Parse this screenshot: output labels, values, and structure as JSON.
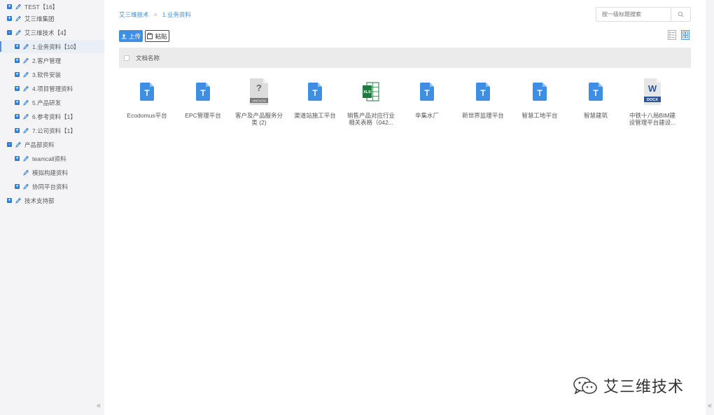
{
  "sidebar": {
    "items": [
      {
        "label": "TEST【16】",
        "toggle": "+"
      },
      {
        "label": "艾三维集团",
        "toggle": "+"
      },
      {
        "label": "艾三维技术【4】",
        "toggle": "-"
      },
      {
        "label": "1.业务资料【10】",
        "toggle": "+"
      },
      {
        "label": "2.客户管理",
        "toggle": "+"
      },
      {
        "label": "3.软件安装",
        "toggle": "+"
      },
      {
        "label": "4.项目管理资料",
        "toggle": "+"
      },
      {
        "label": "5.产品研发",
        "toggle": "+"
      },
      {
        "label": "6.参考资料【1】",
        "toggle": "+"
      },
      {
        "label": "7.公司资料【1】",
        "toggle": "+"
      },
      {
        "label": "产品部资料",
        "toggle": "-"
      },
      {
        "label": "teamcall资料",
        "toggle": "+"
      },
      {
        "label": "模拟构建资料",
        "toggle": ""
      },
      {
        "label": "协同平台资料",
        "toggle": "+"
      },
      {
        "label": "技术支持部",
        "toggle": "+"
      }
    ],
    "collapse": "«"
  },
  "breadcrumb": {
    "root": "艾三维技术",
    "separator": ">",
    "current": "1.业务资料"
  },
  "search": {
    "placeholder": "按一级标题搜索"
  },
  "toolbar": {
    "upload_label": "上传",
    "paste_label": "粘贴"
  },
  "table": {
    "header": "文档名称"
  },
  "files": [
    {
      "name": "Ecodomus平台",
      "type": "T"
    },
    {
      "name": "EPC管理平台",
      "type": "T"
    },
    {
      "name": "客户及产品服务分类 (2)",
      "type": "UNKNOW"
    },
    {
      "name": "渠道站施工平台",
      "type": "T"
    },
    {
      "name": "销售产品对应行业相关表格（042...",
      "type": "XLS"
    },
    {
      "name": "辛集水厂",
      "type": "T"
    },
    {
      "name": "新世界监理平台",
      "type": "T"
    },
    {
      "name": "智慧工地平台",
      "type": "T"
    },
    {
      "name": "智慧建筑",
      "type": "T"
    },
    {
      "name": "中铁十八局BIM建设管理平台建设...",
      "type": "DOCX"
    }
  ],
  "icon_labels": {
    "unknown": "UNKNOW",
    "xls": "XLS",
    "word": "W",
    "docx": "DOCX"
  },
  "watermark": {
    "text": "艾三维技术"
  },
  "right_collapse": "«",
  "colors": {
    "accent": "#3e8fe3",
    "tree_toggle": "#2d7bd8",
    "excel": "#1e7a3e",
    "word": "#2b579a"
  }
}
